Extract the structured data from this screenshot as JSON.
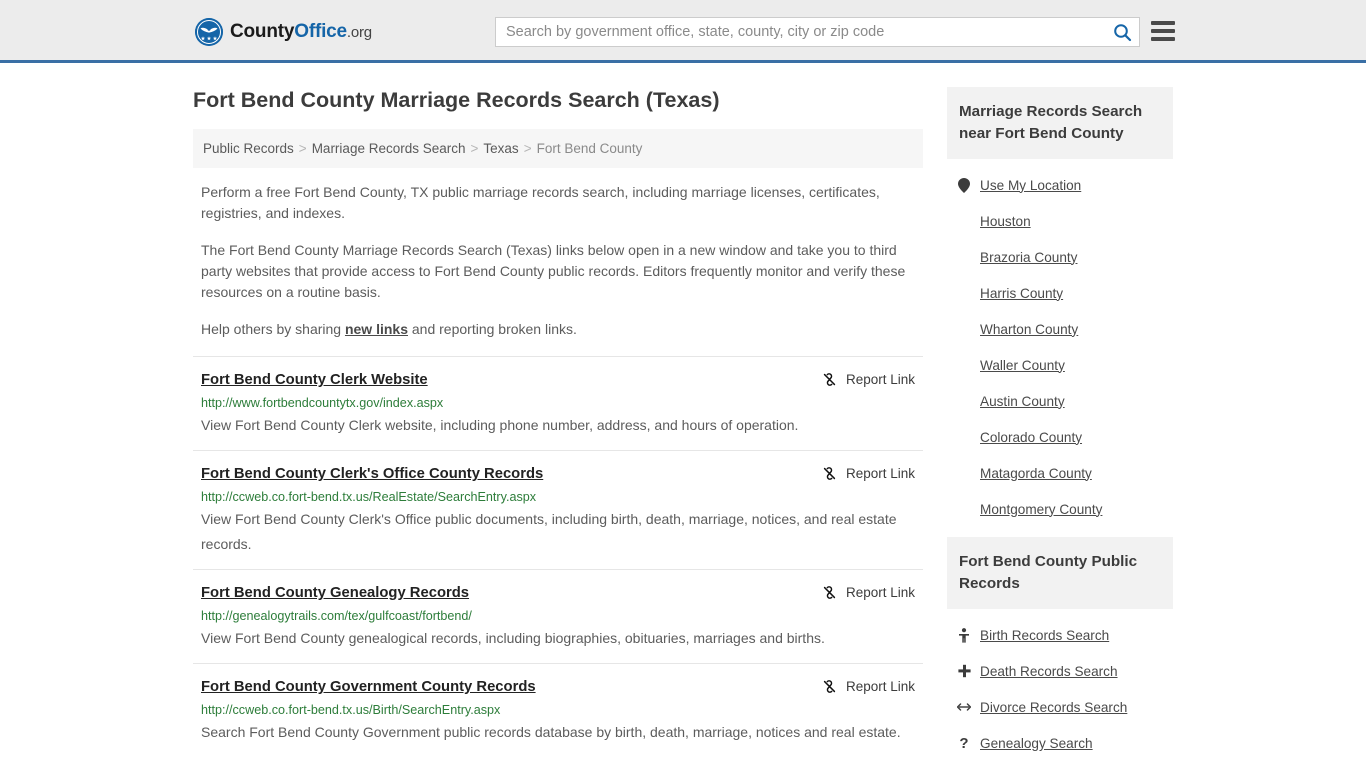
{
  "header": {
    "logo": {
      "word1": "County",
      "word2": "Office",
      "tld": ".org",
      "icon": "eagle-seal-icon"
    },
    "search": {
      "placeholder": "Search by government office, state, county, city or zip code",
      "value": "",
      "button_icon": "search-icon"
    },
    "menu_icon": "hamburger-menu-icon",
    "accent_color": "#3a6fa5"
  },
  "main": {
    "title": "Fort Bend County Marriage Records Search (Texas)",
    "breadcrumb": [
      {
        "label": "Public Records",
        "current": false
      },
      {
        "label": "Marriage Records Search",
        "current": false
      },
      {
        "label": "Texas",
        "current": false
      },
      {
        "label": "Fort Bend County",
        "current": true
      }
    ],
    "breadcrumb_separator": ">",
    "intro": {
      "p1": "Perform a free Fort Bend County, TX public marriage records search, including marriage licenses, certificates, registries, and indexes.",
      "p2": "The Fort Bend County Marriage Records Search (Texas) links below open in a new window and take you to third party websites that provide access to Fort Bend County public records. Editors frequently monitor and verify these resources on a routine basis.",
      "p3_before": "Help others by sharing ",
      "p3_link": "new links",
      "p3_after": " and reporting broken links."
    },
    "report_link_label": "Report Link",
    "report_link_icon": "broken-link-icon",
    "results": [
      {
        "title": "Fort Bend County Clerk Website",
        "url": "http://www.fortbendcountytx.gov/index.aspx",
        "description": "View Fort Bend County Clerk website, including phone number, address, and hours of operation."
      },
      {
        "title": "Fort Bend County Clerk's Office County Records",
        "url": "http://ccweb.co.fort-bend.tx.us/RealEstate/SearchEntry.aspx",
        "description": "View Fort Bend County Clerk's Office public documents, including birth, death, marriage, notices, and real estate records."
      },
      {
        "title": "Fort Bend County Genealogy Records",
        "url": "http://genealogytrails.com/tex/gulfcoast/fortbend/",
        "description": "View Fort Bend County genealogical records, including biographies, obituaries, marriages and births."
      },
      {
        "title": "Fort Bend County Government County Records",
        "url": "http://ccweb.co.fort-bend.tx.us/Birth/SearchEntry.aspx",
        "description": "Search Fort Bend County Government public records database by birth, death, marriage, notices and real estate."
      }
    ]
  },
  "sidebar": {
    "nearby": {
      "heading": "Marriage Records Search near Fort Bend County",
      "items": [
        {
          "label": "Use My Location",
          "icon": "map-pin-icon"
        },
        {
          "label": "Houston",
          "icon": ""
        },
        {
          "label": "Brazoria County",
          "icon": ""
        },
        {
          "label": "Harris County",
          "icon": ""
        },
        {
          "label": "Wharton County",
          "icon": ""
        },
        {
          "label": "Waller County",
          "icon": ""
        },
        {
          "label": "Austin County",
          "icon": ""
        },
        {
          "label": "Colorado County",
          "icon": ""
        },
        {
          "label": "Matagorda County",
          "icon": ""
        },
        {
          "label": "Montgomery County",
          "icon": ""
        }
      ]
    },
    "public_records": {
      "heading": "Fort Bend County Public Records",
      "items": [
        {
          "label": "Birth Records Search",
          "icon": "baby-icon"
        },
        {
          "label": "Death Records Search",
          "icon": "cross-icon"
        },
        {
          "label": "Divorce Records Search",
          "icon": "left-right-arrow-icon"
        },
        {
          "label": "Genealogy Search",
          "icon": "question-mark-icon"
        }
      ]
    }
  }
}
